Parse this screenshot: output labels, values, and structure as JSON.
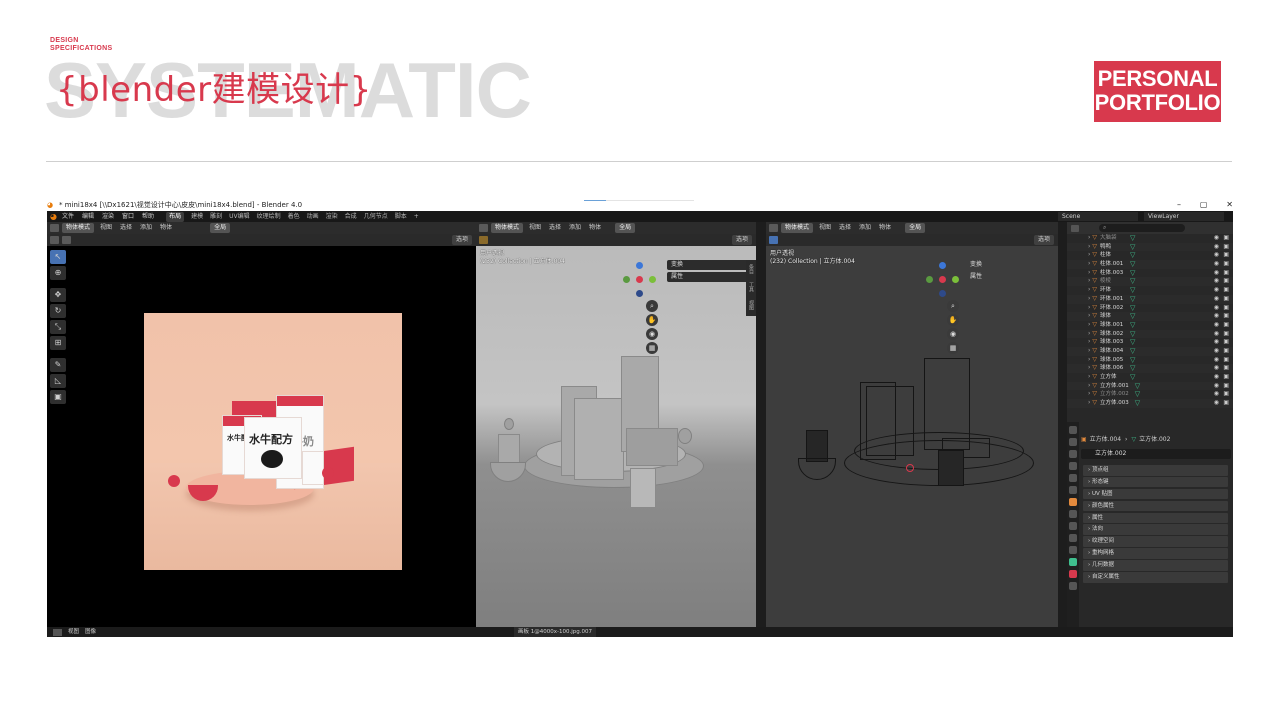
{
  "slide": {
    "kicker_line1": "DESIGN",
    "kicker_line2": "SPECIFICATIONS",
    "bg_word": "SYSTEMATIC",
    "title": "{blender建模设计}",
    "badge_line1": "PERSONAL",
    "badge_line2": "PORTFOLIO",
    "accent_color": "#d8394d"
  },
  "window": {
    "title": "* mini18x4 [\\\\Dx1621\\视觉设计中心\\皮皮\\mini18x4.blend] - Blender 4.0",
    "buttons": [
      "–",
      "▢",
      "✕"
    ]
  },
  "menubar": {
    "menus": [
      "文件",
      "编辑",
      "渲染",
      "窗口",
      "帮助"
    ],
    "workspaces": [
      "布局",
      "建模",
      "雕刻",
      "UV编辑",
      "纹理绘制",
      "着色",
      "动画",
      "渲染",
      "合成",
      "几何节点",
      "脚本"
    ],
    "active_workspace": "布局",
    "scene_label": "Scene",
    "viewlayer_label": "ViewLayer"
  },
  "image_editor": {
    "mode": "物体模式",
    "menus": [
      "视图",
      "选择",
      "添加",
      "物体"
    ],
    "pivot": "全局",
    "options": "选项",
    "packaging_text": "水牛配方",
    "packaging_subtext": "水牛奶",
    "tools": [
      "select-icon",
      "cursor-icon",
      "move-icon",
      "rotate-icon",
      "scale-icon",
      "transform-icon",
      "annotate-icon",
      "measure-icon",
      "add-cube-icon"
    ]
  },
  "viewport_mid": {
    "mode": "物体模式",
    "menus": [
      "视图",
      "选择",
      "添加",
      "物体"
    ],
    "pivot": "全局",
    "options": "选项",
    "label_line1": "用户透视",
    "label_line2": "(232) Collection | 立方体.004",
    "npanel": [
      "变换",
      "属性"
    ],
    "side_tabs": [
      "条目",
      "工具",
      "视图"
    ]
  },
  "viewport_right": {
    "mode": "物体模式",
    "menus": [
      "视图",
      "选择",
      "添加",
      "物体"
    ],
    "pivot": "全局",
    "options": "选项",
    "label_line1": "用户透视",
    "label_line2": "(232) Collection | 立方体.004",
    "npanel": [
      "变换",
      "属性"
    ]
  },
  "outliner": {
    "search_placeholder": "",
    "rows": [
      {
        "name": "大脑袋",
        "dim": true
      },
      {
        "name": "鸭鸭",
        "dim": false
      },
      {
        "name": "柱体",
        "dim": false
      },
      {
        "name": "柱体.001",
        "dim": false
      },
      {
        "name": "柱体.003",
        "dim": false
      },
      {
        "name": "棱棱",
        "dim": true
      },
      {
        "name": "环体",
        "dim": false
      },
      {
        "name": "环体.001",
        "dim": false
      },
      {
        "name": "环体.002",
        "dim": false
      },
      {
        "name": "球体",
        "dim": false
      },
      {
        "name": "球体.001",
        "dim": false
      },
      {
        "name": "球体.002",
        "dim": false
      },
      {
        "name": "球体.003",
        "dim": false
      },
      {
        "name": "球体.004",
        "dim": false
      },
      {
        "name": "球体.005",
        "dim": false
      },
      {
        "name": "球体.006",
        "dim": false
      },
      {
        "name": "立方体",
        "dim": false
      },
      {
        "name": "立方体.001",
        "dim": false
      },
      {
        "name": "立方体.002",
        "dim": true
      },
      {
        "name": "立方体.003",
        "dim": false
      }
    ]
  },
  "properties": {
    "breadcrumb_object": "立方体.004",
    "breadcrumb_mesh": "立方体.002",
    "data_name": "立方体.002",
    "panels": [
      "顶点组",
      "形态键",
      "UV 贴图",
      "颜色属性",
      "属性",
      "法向",
      "纹理空间",
      "重构网格",
      "几何数据",
      "自定义属性"
    ]
  },
  "status": {
    "left_menus": [
      "视图",
      "图像"
    ],
    "center": "画板 1@4000x-100.jpg.007"
  }
}
